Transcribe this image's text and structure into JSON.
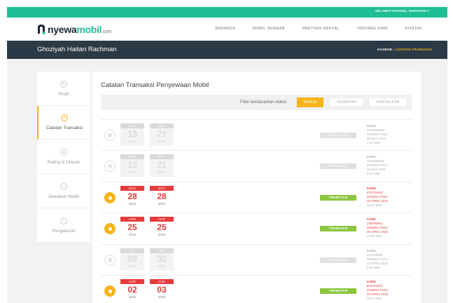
{
  "topbar": {
    "greeting": "SELAMAT DATANG, GHOZIYAH ▾"
  },
  "brand": {
    "name_main": "nyewa",
    "name_accent": "mobil",
    "name_suffix": ".com"
  },
  "nav": {
    "items": [
      "BERANDA",
      "MOBIL SEWAAN",
      "PARTNER RENTAL",
      "TENTANG KAMI",
      "KONTAK"
    ]
  },
  "header": {
    "user_name": "Ghoziyah Haitan Rachman",
    "breadcrumb_root": "DASBOR",
    "breadcrumb_sep": " › ",
    "breadcrumb_current": "CATATAN TRANSAKSI"
  },
  "sidebar": {
    "items": [
      {
        "label": "Profil",
        "icon": "user-icon",
        "glyph": "A",
        "active": false
      },
      {
        "label": "Catatan Transaksi",
        "icon": "receipt-icon",
        "glyph": "☰",
        "active": true
      },
      {
        "label": "Rating & Ulasan",
        "icon": "chart-icon",
        "glyph": "▲",
        "active": false
      },
      {
        "label": "Sewakan Mobil",
        "icon": "car-icon",
        "glyph": "▭",
        "active": false
      },
      {
        "label": "Pengaturan",
        "icon": "gear-icon",
        "glyph": "≡",
        "active": false
      }
    ]
  },
  "main": {
    "title": "Catatan Transaksi Penyewaan Mobil",
    "filter_label": "Filter berdasarkan status:",
    "filters": [
      {
        "label": "SEMUA",
        "active": true
      },
      {
        "label": "TERBAYAR",
        "active": false
      },
      {
        "label": "DIBATALKAN",
        "active": false
      }
    ]
  },
  "transactions": [
    {
      "active": false,
      "start": {
        "month": "NOV",
        "day": "13",
        "year": "2015"
      },
      "end": {
        "month": "NOV",
        "day": "21",
        "year": "2015"
      },
      "status": "DIBATALKAN",
      "kode_label": "KODE",
      "kode": "2015050565",
      "disewa": "DISEWA PADA",
      "date": "05 MAY 2015",
      "time": "0:47 WIB"
    },
    {
      "active": false,
      "start": {
        "month": "NOV",
        "day": "13",
        "year": "2015"
      },
      "end": {
        "month": "NOV",
        "day": "21",
        "year": "2015"
      },
      "status": "DIBATALKAN",
      "kode_label": "KODE",
      "kode": "2015050564",
      "disewa": "DISEWA PADA",
      "date": "05 MAY 2015",
      "time": "0:41 WIB"
    },
    {
      "active": true,
      "start": {
        "month": "NOV",
        "day": "28",
        "year": "2015"
      },
      "end": {
        "month": "NOV",
        "day": "28",
        "year": "2015"
      },
      "status": "TERBAYAR",
      "kode_label": "KODE",
      "kode": "975726463",
      "disewa": "DISEWA PADA",
      "date": "25 APRIL 2015",
      "time": "15:24 WIB"
    },
    {
      "active": true,
      "start": {
        "month": "APR",
        "day": "25",
        "year": "2015"
      },
      "end": {
        "month": "APR",
        "day": "25",
        "year": "2015"
      },
      "status": "TERBAYAR",
      "kode_label": "KODE",
      "kode": "246260562",
      "disewa": "DISEWA PADA",
      "date": "25 APRIL 2015",
      "time": "13:26 WIB"
    },
    {
      "active": false,
      "start": {
        "month": "JUL",
        "day": "09",
        "year": "2015"
      },
      "end": {
        "month": "OKT",
        "day": "30",
        "year": "2015"
      },
      "status": "DIBATALKAN",
      "kode_label": "KODE",
      "kode": "267083565",
      "disewa": "DISEWA PADA",
      "date": "23 APRIL 2015",
      "time": "0:25 WIB"
    },
    {
      "active": true,
      "start": {
        "month": "JUN",
        "day": "02",
        "year": "2015"
      },
      "end": {
        "month": "JUN",
        "day": "03",
        "year": "2015"
      },
      "status": "TERBAYAR",
      "kode_label": "KODE",
      "kode": "B11101008",
      "disewa": "DISEWA PADA",
      "date": "20 APRIL 2015",
      "time": "20:21 WIB"
    }
  ],
  "colors": {
    "accent_green": "#1fbf95",
    "accent_yellow": "#f5b41a",
    "header_dark": "#2b3a47",
    "paid_green": "#8cc63f",
    "date_red": "#e53b3b"
  }
}
